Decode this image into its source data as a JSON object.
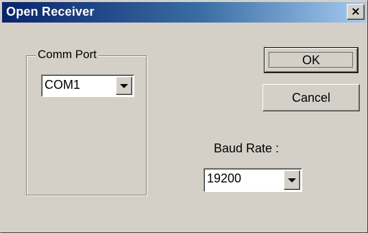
{
  "window": {
    "title": "Open Receiver",
    "close_glyph": "×",
    "titlebar_colors": [
      "#0a246a",
      "#3a6ea5",
      "#a6caf0"
    ]
  },
  "comm_port": {
    "group_label": "Comm Port",
    "selected": "COM1"
  },
  "buttons": {
    "ok_label": "OK",
    "cancel_label": "Cancel"
  },
  "baud_rate": {
    "label": "Baud Rate :",
    "selected": "19200"
  },
  "icons": {
    "close": "close-icon",
    "dropdown": "chevron-down-icon"
  }
}
